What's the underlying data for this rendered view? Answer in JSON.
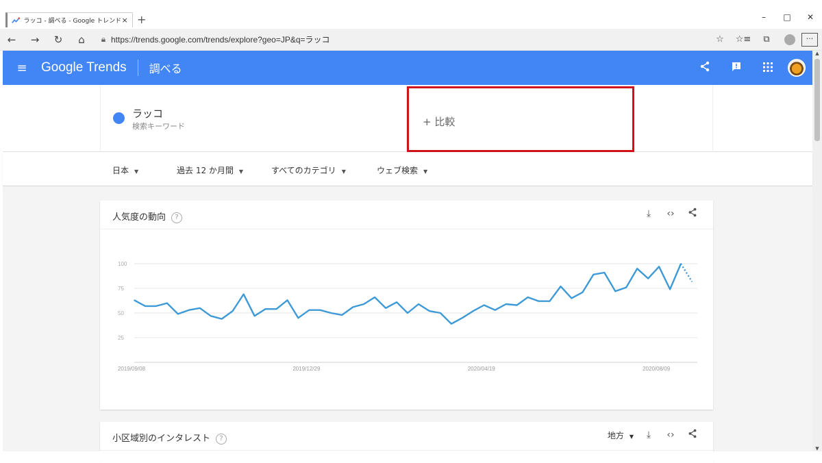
{
  "browser": {
    "tab_title": "ラッコ - 調べる - Google トレンド",
    "tab_close": "×",
    "new_tab": "+",
    "url": "https://trends.google.com/trends/explore?geo=JP&q=ラッコ",
    "window_controls": [
      "–",
      "□",
      "✕"
    ]
  },
  "header": {
    "brand": "Google Trends",
    "section": "調べる"
  },
  "search": {
    "term": "ラッコ",
    "term_type": "検索キーワード",
    "term_color": "#4285f4",
    "compare_label": "+ 比較",
    "compare_highlight_color": "#d0121b"
  },
  "filters": {
    "region": "日本",
    "period": "過去 12 か月間",
    "category": "すべてのカテゴリ",
    "search_type": "ウェブ検索"
  },
  "trend_card": {
    "title": "人気度の動向",
    "help": "?"
  },
  "region_card": {
    "title": "小区域別のインタレスト",
    "help": "?",
    "region_select": "地方"
  },
  "chart_data": {
    "type": "line",
    "xlabel": "",
    "ylabel": "",
    "ylim": [
      0,
      100
    ],
    "yticks": [
      25,
      50,
      75,
      100
    ],
    "xtick_labels": [
      "2019/09/08",
      "2019/12/29",
      "2020/04/19",
      "2020/08/09"
    ],
    "xtick_index": [
      0,
      16,
      32,
      48
    ],
    "grid": true,
    "color": "#4285f4",
    "series": [
      {
        "values": [
          63,
          57,
          57,
          60,
          49,
          53,
          55,
          47,
          44,
          52,
          69,
          47,
          54,
          54,
          63,
          45,
          53,
          53,
          50,
          48,
          56,
          59,
          66,
          55,
          61,
          50,
          59,
          52,
          50,
          39,
          45,
          52,
          58,
          53,
          59,
          58,
          66,
          62,
          62,
          77,
          65,
          71,
          89,
          91,
          72,
          76,
          95,
          85,
          97,
          74,
          100,
          82
        ],
        "partial_last_points": 2
      }
    ]
  }
}
